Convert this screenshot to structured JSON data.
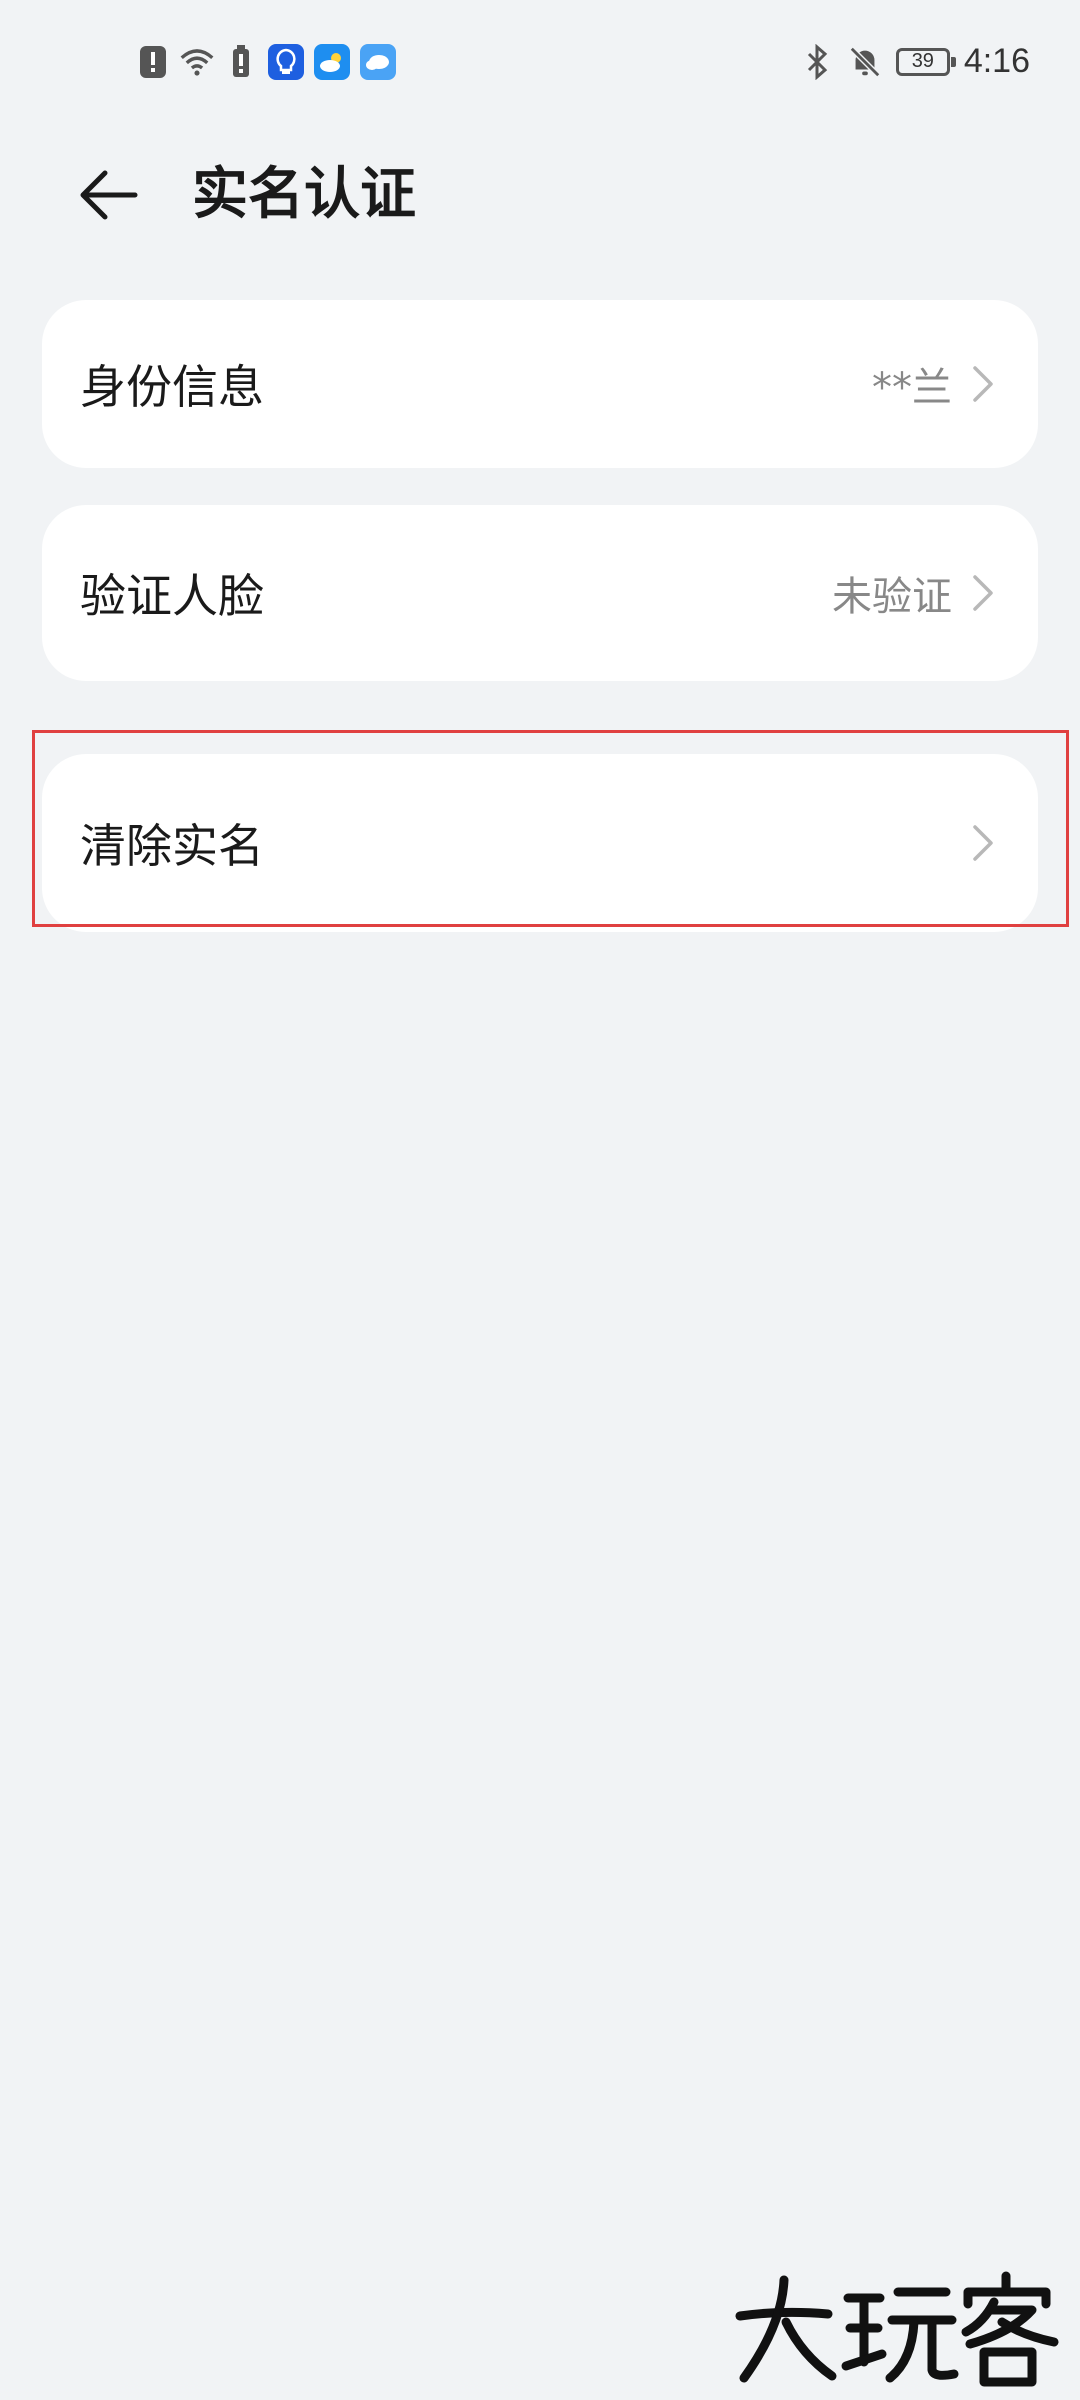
{
  "status_bar": {
    "time": "4:16",
    "battery_level": "39",
    "left_icons": [
      "alert-icon",
      "wifi-icon",
      "battery-saver-icon",
      "lightbulb-app-icon",
      "weather-app-icon",
      "cloud-app-icon"
    ],
    "right_icons": [
      "bluetooth-icon",
      "mute-icon",
      "battery-icon"
    ]
  },
  "header": {
    "title": "实名认证",
    "back_icon": "back-arrow-icon"
  },
  "items": [
    {
      "label": "身份信息",
      "value": "**兰"
    },
    {
      "label": "验证人脸",
      "value": "未验证"
    },
    {
      "label": "清除实名",
      "value": ""
    }
  ],
  "watermark": {
    "text": "大玩客"
  },
  "colors": {
    "background": "#f1f3f5",
    "card": "#ffffff",
    "highlight": "#e04040",
    "secondary_text": "#888888"
  }
}
